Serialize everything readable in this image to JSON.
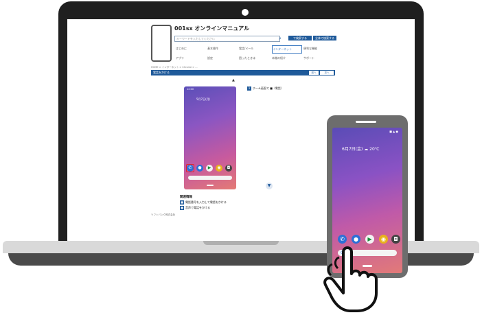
{
  "page": {
    "title": "001sx オンラインマニュアル",
    "search_placeholder": "キーワードを入力してください",
    "search_buttons": [
      "で検索する",
      "全体で検索する"
    ],
    "menu": [
      "はじめに",
      "基本操作",
      "電話/メール",
      "インターネット",
      "便利な機能",
      "アプリ",
      "設定",
      "困ったときは",
      "本機の紹介",
      "サポート"
    ],
    "active_menu_index": 3,
    "breadcrumb": "HOME > インターネット > Chrome > ...",
    "section_title": "電話をかける",
    "section_buttons": [
      "前へ",
      "次へ"
    ],
    "step_text": "ホーム画面で ■（電話）",
    "related_title": "関連情報",
    "related_items": [
      "電話番号を入力して電話をかける",
      "音声で電話をかける"
    ],
    "footer_text": "ソフトバンク株式会社"
  },
  "mini_phone": {
    "status_time": "12:00",
    "date_text": "5月7日(月)",
    "dock_icons": [
      "phone-icon",
      "messages-icon",
      "play-store-icon",
      "chrome-icon",
      "camera-icon"
    ]
  },
  "phone": {
    "date_text": "6月7日(金) ☁ 20℃",
    "status_right": "■ ▲ ●",
    "dock_icons": [
      "phone-icon",
      "messages-icon",
      "play-store-icon",
      "chrome-icon",
      "camera-icon"
    ],
    "search_bar_glyph": "G"
  },
  "colors": {
    "bezel": "#1f1f1f",
    "accent": "#1f5a9a",
    "highlight": "#e0242a",
    "phone_body": "#6d6d6d"
  }
}
